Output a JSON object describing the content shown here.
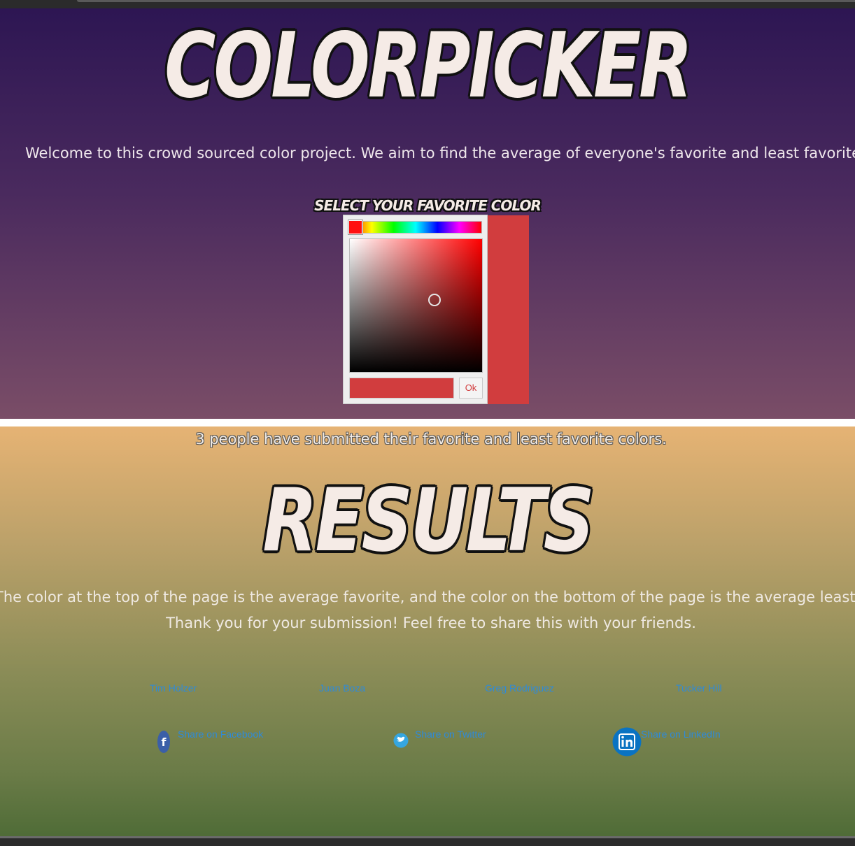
{
  "header": {
    "title": "COLORPICKER",
    "welcome": "Welcome to this crowd sourced color project. We aim to find the average of everyone's favorite and least favorite colors."
  },
  "picker": {
    "label": "SELECT YOUR FAVORITE COLOR",
    "selected_color": "#d13d3e",
    "hue_color": "#ff0000",
    "ok_label": "Ok"
  },
  "results": {
    "count_text": "3 people have submitted their favorite and least favorite colors.",
    "title": "RESULTS",
    "explanation": "The color at the top of the page is the average favorite, and the color on the bottom of the page is the average least favorite.",
    "thanks": "Thank you for your submission! Feel free to share this with your friends."
  },
  "authors": [
    "Tim Holzer",
    "Juan Boza",
    "Greg Rodriguez",
    "Tucker Hill"
  ],
  "share": {
    "facebook": {
      "label": "Share on Facebook",
      "icon": "facebook-icon"
    },
    "twitter": {
      "label": "Share on Twitter",
      "icon": "twitter-icon"
    },
    "linkedin": {
      "label": "Share on LinkedIn",
      "icon": "linkedin-icon"
    }
  },
  "colors": {
    "top_gradient_start": "#2d1653",
    "top_gradient_end": "#7a4d67",
    "bottom_gradient_start": "#e6b374",
    "bottom_gradient_end": "#4f6c37",
    "link": "#2f8ad8"
  }
}
